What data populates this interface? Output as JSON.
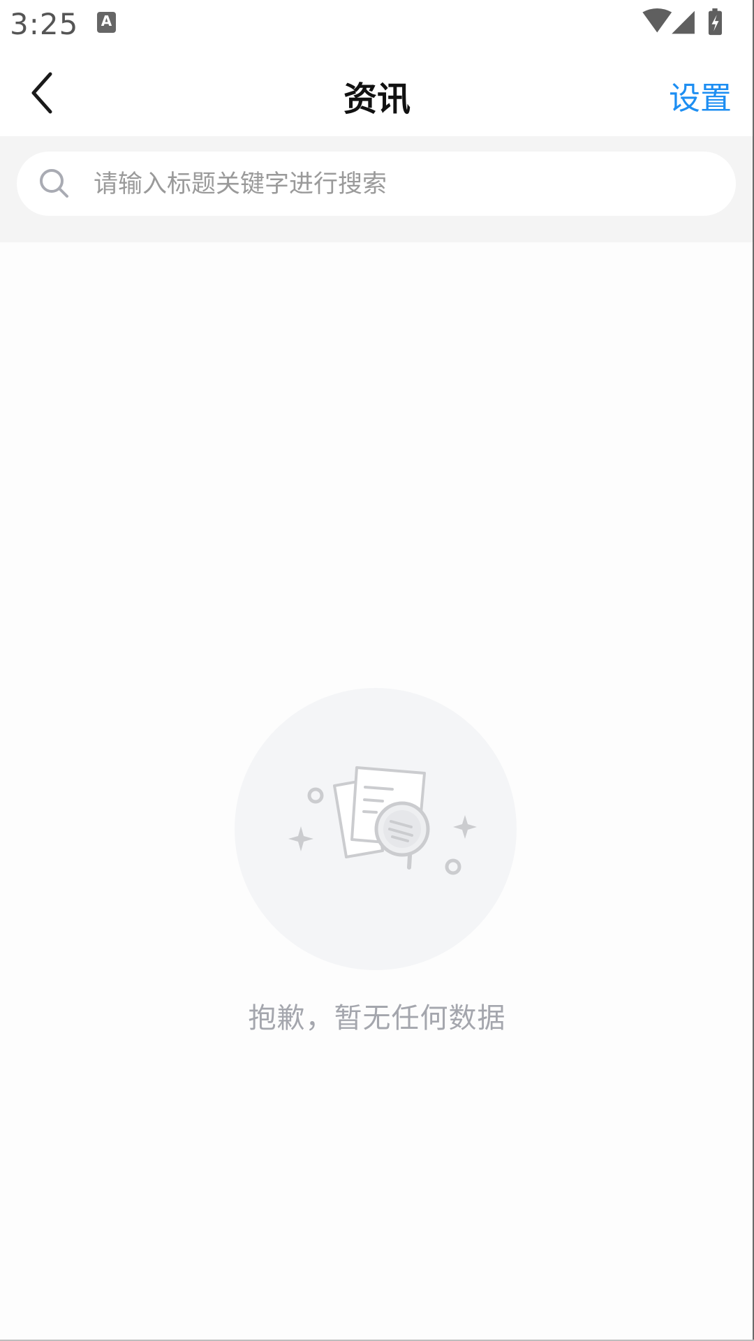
{
  "status_bar": {
    "time": "3:25",
    "notification_icon": "a-keyboard-icon",
    "notification_letter": "A",
    "icons": [
      "wifi-icon",
      "signal-icon",
      "battery-charging-icon"
    ]
  },
  "header": {
    "back_icon": "chevron-left-icon",
    "title": "资讯",
    "settings_label": "设置",
    "accent_color": "#1d8ef2"
  },
  "search": {
    "icon": "search-icon",
    "placeholder": "请输入标题关键字进行搜索",
    "value": ""
  },
  "empty_state": {
    "illustration": "empty-documents-magnifier-icon",
    "message": "抱歉，暂无任何数据"
  }
}
